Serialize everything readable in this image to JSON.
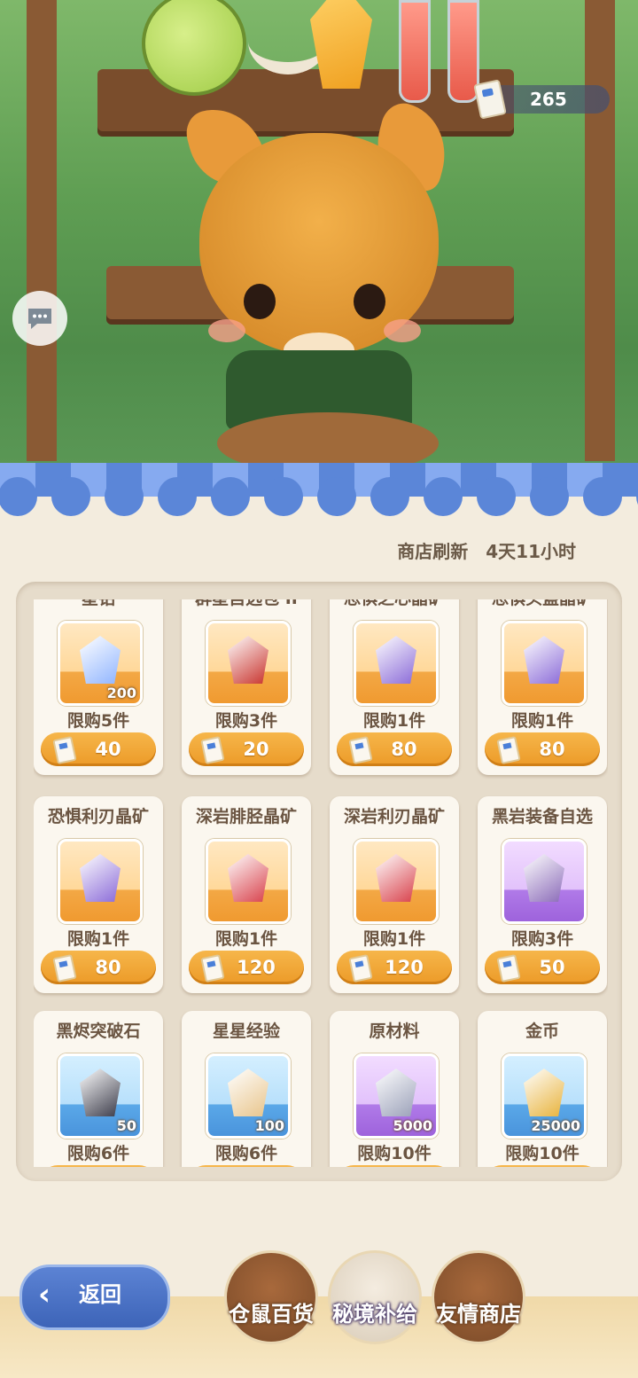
{
  "header": {
    "currency_amount": "265",
    "chat_icon": "chat-bubble-icon"
  },
  "shop": {
    "refresh_label": "商店刷新",
    "refresh_time": "4天11小时",
    "items": [
      {
        "name": "星钻",
        "qty": "200",
        "limit": "限购5件",
        "price": "40",
        "bg": "orange",
        "icon": "star-diamond-icon",
        "gem_color": "#8fb4ff"
      },
      {
        "name": "群星自选包 II",
        "qty": "",
        "limit": "限购3件",
        "price": "20",
        "bg": "orange",
        "icon": "card-pack-icon",
        "gem_color": "#c8322c"
      },
      {
        "name": "恐惧之心晶矿",
        "qty": "",
        "limit": "限购1件",
        "price": "80",
        "bg": "orange",
        "icon": "purple-crystal-icon",
        "gem_color": "#8a6ad8"
      },
      {
        "name": "恐惧头盔晶矿",
        "qty": "",
        "limit": "限购1件",
        "price": "80",
        "bg": "orange",
        "icon": "purple-crystal-icon",
        "gem_color": "#8a6ad8"
      },
      {
        "name": "恐惧利刃晶矿",
        "qty": "",
        "limit": "限购1件",
        "price": "80",
        "bg": "orange",
        "icon": "purple-crystal-icon",
        "gem_color": "#8a6ad8"
      },
      {
        "name": "深岩腓胫晶矿",
        "qty": "",
        "limit": "限购1件",
        "price": "120",
        "bg": "orange",
        "icon": "red-crystal-icon",
        "gem_color": "#d8404a"
      },
      {
        "name": "深岩利刃晶矿",
        "qty": "",
        "limit": "限购1件",
        "price": "120",
        "bg": "orange",
        "icon": "red-crystal-icon",
        "gem_color": "#d8404a"
      },
      {
        "name": "黑岩装备自选",
        "qty": "",
        "limit": "限购3件",
        "price": "50",
        "bg": "purple",
        "icon": "treasure-chest-icon",
        "gem_color": "#8a6ab8"
      },
      {
        "name": "黑烬突破石",
        "qty": "50",
        "limit": "限购6件",
        "price": "",
        "bg": "blue",
        "icon": "breakthrough-stone-icon",
        "gem_color": "#3a3a48"
      },
      {
        "name": "星星经验",
        "qty": "100",
        "limit": "限购6件",
        "price": "",
        "bg": "blue",
        "icon": "star-exp-card-icon",
        "gem_color": "#e8c48a"
      },
      {
        "name": "原材料",
        "qty": "5000",
        "limit": "限购10件",
        "price": "",
        "bg": "purple",
        "icon": "ingot-icon",
        "gem_color": "#9aa0b8"
      },
      {
        "name": "金币",
        "qty": "25000",
        "limit": "限购10件",
        "price": "",
        "bg": "blue",
        "icon": "gold-coin-icon",
        "gem_color": "#e8b23a"
      }
    ]
  },
  "nav": {
    "back_label": "返回",
    "tabs": [
      {
        "label": "仓鼠百货",
        "icon": "hamster-icon",
        "color": "#a8693c"
      },
      {
        "label": "秘境补给",
        "icon": "eye-emblem-icon",
        "color": "#f4ece0"
      },
      {
        "label": "友情商店",
        "icon": "crystal-ball-icon",
        "color": "#a8693c"
      }
    ]
  }
}
